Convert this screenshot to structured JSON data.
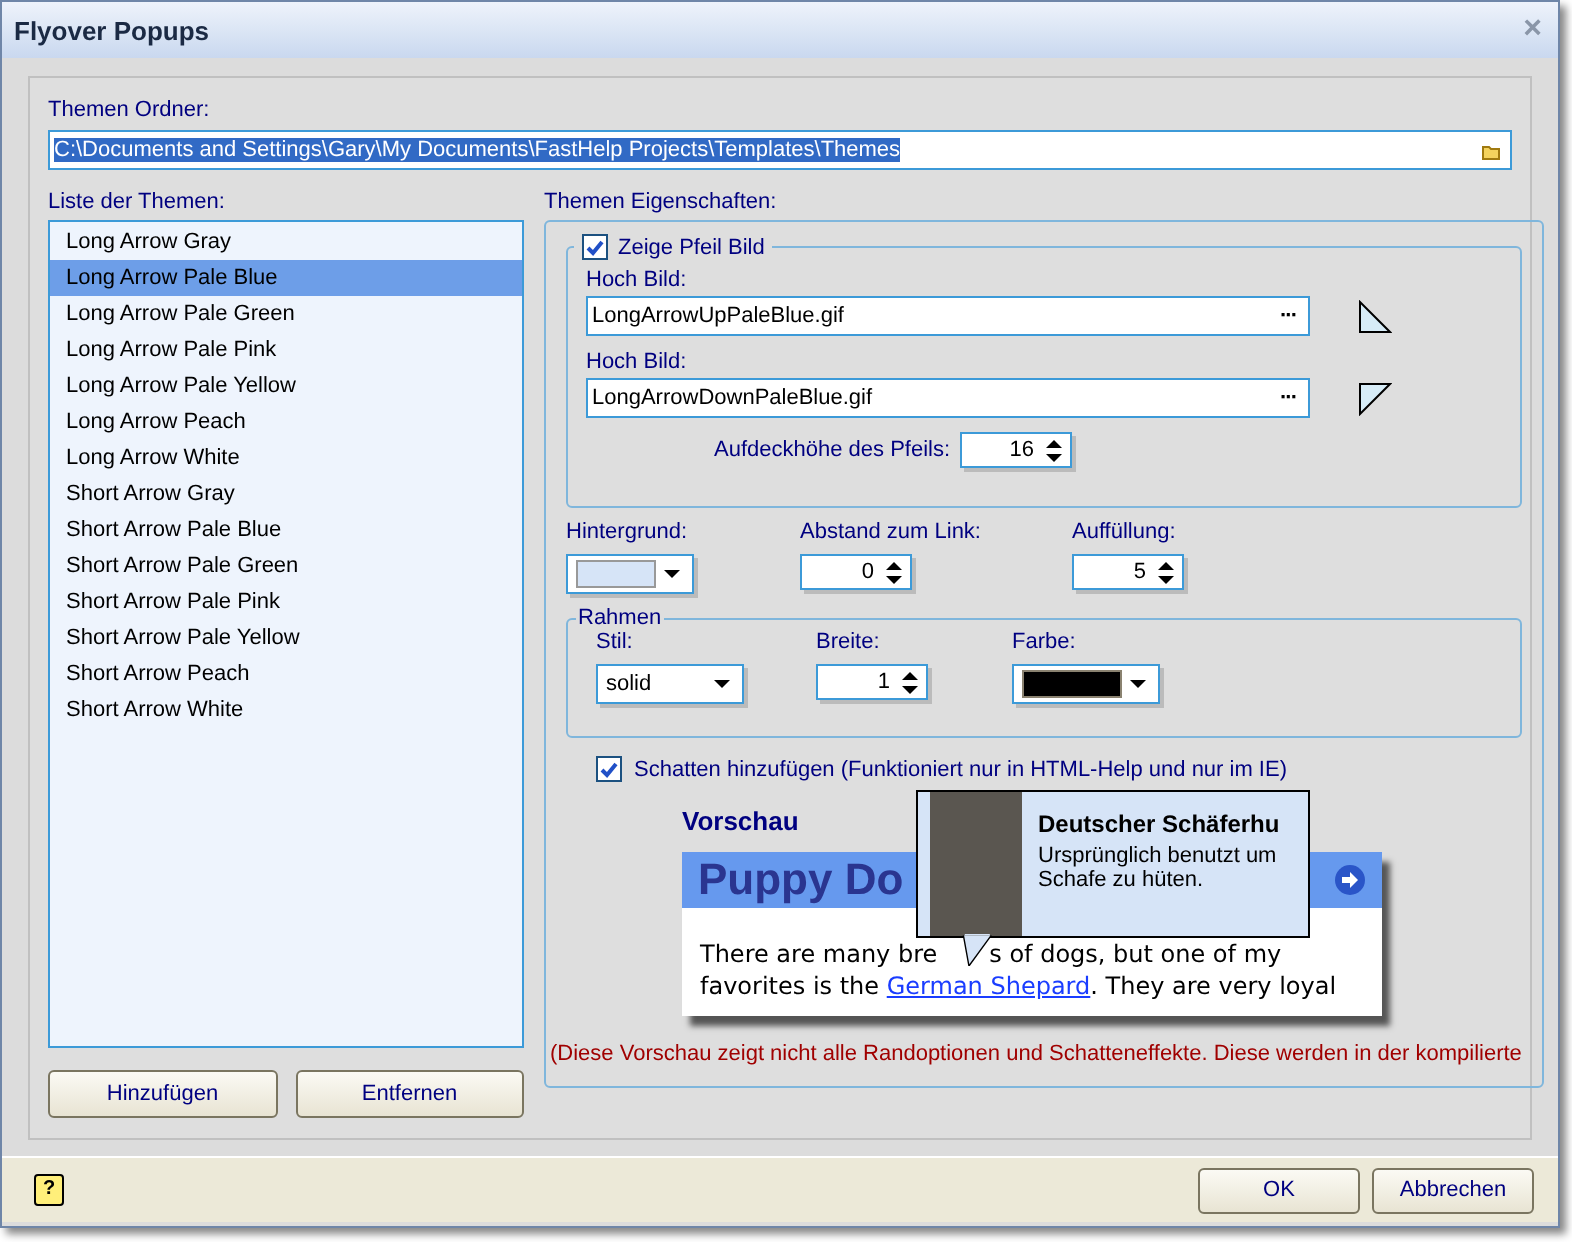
{
  "window": {
    "title": "Flyover Popups",
    "close": "×"
  },
  "folder": {
    "label": "Themen Ordner:",
    "value": "C:\\Documents and Settings\\Gary\\My Documents\\FastHelp Projects\\Templates\\Themes"
  },
  "themes": {
    "label": "Liste der Themen:",
    "items": [
      {
        "label": "Long Arrow Gray",
        "selected": false
      },
      {
        "label": "Long Arrow Pale Blue",
        "selected": true
      },
      {
        "label": "Long Arrow Pale Green",
        "selected": false
      },
      {
        "label": "Long Arrow Pale Pink",
        "selected": false
      },
      {
        "label": "Long Arrow Pale Yellow",
        "selected": false
      },
      {
        "label": "Long Arrow Peach",
        "selected": false
      },
      {
        "label": "Long Arrow White",
        "selected": false
      },
      {
        "label": "Short Arrow Gray",
        "selected": false
      },
      {
        "label": "Short Arrow Pale Blue",
        "selected": false
      },
      {
        "label": "Short Arrow Pale Green",
        "selected": false
      },
      {
        "label": "Short Arrow Pale Pink",
        "selected": false
      },
      {
        "label": "Short Arrow Pale Yellow",
        "selected": false
      },
      {
        "label": "Short Arrow Peach",
        "selected": false
      },
      {
        "label": "Short Arrow White",
        "selected": false
      }
    ],
    "buttons": [
      "Hinzufügen",
      "Entfernen"
    ]
  },
  "properties": {
    "label": "Themen Eigenschaften:",
    "show_arrow": {
      "label": "Zeige Pfeil Bild",
      "checked": true
    },
    "images": [
      {
        "label": "Hoch Bild:",
        "value": "LongArrowUpPaleBlue.gif",
        "browse": "···",
        "kind": "up"
      },
      {
        "label": "Hoch Bild:",
        "value": "LongArrowDownPaleBlue.gif",
        "browse": "···",
        "kind": "down"
      }
    ],
    "reveal_height": {
      "label": "Aufdeckhöhe des Pfeils:",
      "value": "16"
    },
    "background": {
      "label": "Hintergrund:",
      "color": "#d6e4f7"
    },
    "link_distance": {
      "label": "Abstand zum Link:",
      "value": "0"
    },
    "padding": {
      "label": "Auffüllung:",
      "value": "5"
    },
    "border": {
      "label": "Rahmen",
      "style": {
        "label": "Stil:",
        "value": "solid"
      },
      "width": {
        "label": "Breite:",
        "value": "1"
      },
      "color": {
        "label": "Farbe:",
        "color": "#000000"
      }
    },
    "shadow": {
      "label": "Schatten hinzufügen (Funktioniert nur in HTML-Help und nur im IE)",
      "checked": true
    },
    "preview": {
      "heading": "Vorschau",
      "title": "Puppy Do",
      "lines": [
        "There are many bre",
        "s of dogs, but one of my"
      ],
      "line2_before": "favorites is the ",
      "link": "German Shepard",
      "line2_after": ". They are very loyal",
      "popup": {
        "title": "Deutscher Schäferhu",
        "text": "Ursprünglich benutzt um Schafe zu hüten."
      }
    },
    "note": "(Diese Vorschau zeigt nicht alle Randoptionen und Schatteneffekte. Diese werden in der kompilierte"
  },
  "footer": {
    "help": "?",
    "buttons": [
      "OK",
      "Abbrechen"
    ]
  }
}
